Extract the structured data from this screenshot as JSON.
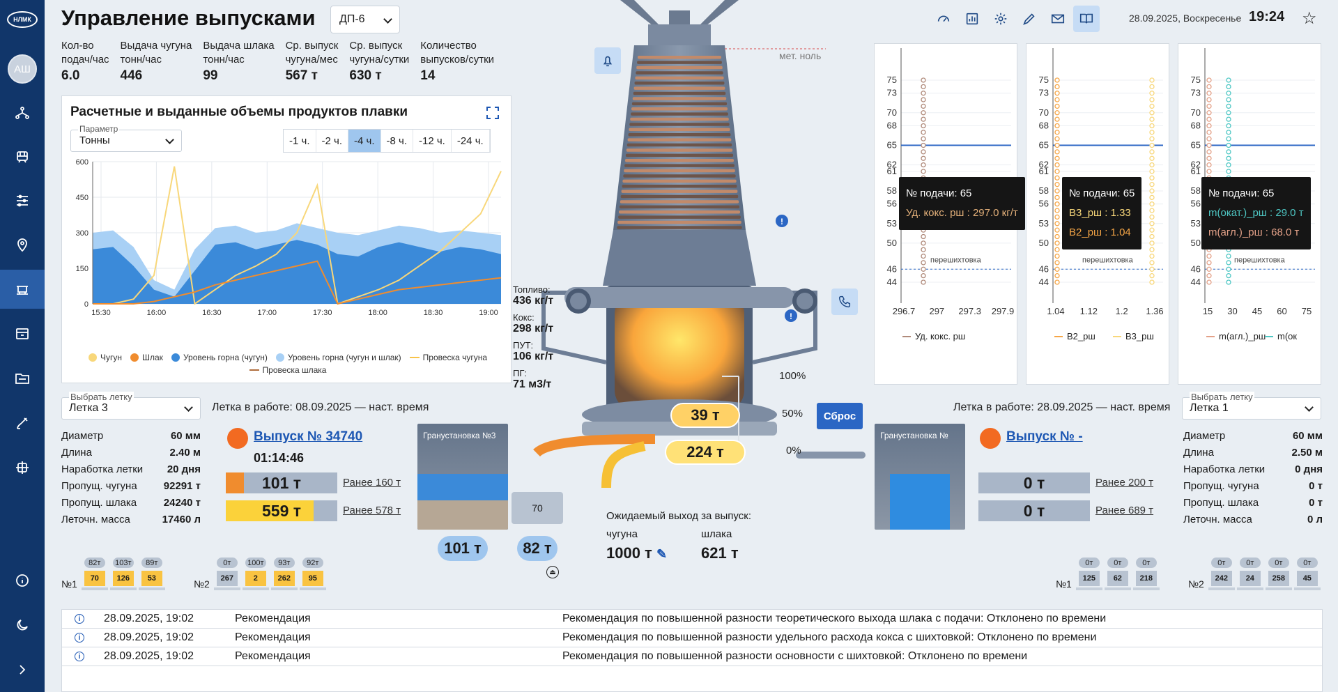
{
  "app": {
    "logo": "НЛМК",
    "user_initials": "АШ"
  },
  "header": {
    "title": "Управление выпусками",
    "furnace": "ДП-6",
    "date": "28.09.2025, Воскресенье",
    "time": "19:24"
  },
  "stats": [
    {
      "label": "Кол-во\nподач/час",
      "value": "6.0"
    },
    {
      "label": "Выдача чугуна\nтонн/час",
      "value": "446"
    },
    {
      "label": "Выдача шлака\nтонн/час",
      "value": "99"
    },
    {
      "label": "Ср. выпуск\nчугуна/мес",
      "value": "567 т"
    },
    {
      "label": "Ср. выпуск\nчугуна/сутки",
      "value": "630 т"
    },
    {
      "label": "Количество\nвыпусков/сутки",
      "value": "14"
    }
  ],
  "chart_panel": {
    "title": "Расчетные и выданные объемы продуктов плавки",
    "param_label": "Параметр",
    "param_value": "Тонны",
    "hour_buttons": [
      "-1 ч.",
      "-2 ч.",
      "-4 ч.",
      "-8 ч.",
      "-12 ч.",
      "-24 ч."
    ],
    "active_hour": "-4 ч.",
    "legend": [
      "Чугун",
      "Шлак",
      "Уровень горна (чугун)",
      "Уровень горна (чугун и шлак)",
      "Провеска чугуна",
      "Провеска шлака"
    ]
  },
  "chart_data": [
    {
      "type": "area",
      "title": "Расчетные и выданные объемы продуктов плавки",
      "x_ticks": [
        "15:30",
        "16:00",
        "16:30",
        "17:00",
        "17:30",
        "18:00",
        "18:30",
        "19:00"
      ],
      "y_ticks": [
        0,
        150,
        300,
        450,
        600
      ],
      "ylim": [
        0,
        600
      ],
      "series": [
        {
          "name": "Уровень горна (чугун и шлак)",
          "color": "#a8d0f5",
          "values": [
            300,
            310,
            240,
            100,
            60,
            230,
            320,
            330,
            300,
            310,
            340,
            320,
            300,
            290,
            310,
            330,
            320,
            300,
            310,
            300,
            290
          ]
        },
        {
          "name": "Уровень горна (чугун)",
          "color": "#3b8ad9",
          "values": [
            230,
            240,
            160,
            60,
            30,
            140,
            250,
            260,
            230,
            250,
            270,
            250,
            210,
            200,
            240,
            260,
            240,
            220,
            240,
            230,
            210
          ]
        },
        {
          "name": "Чугун",
          "color": "#f8d77a",
          "values": [
            0,
            0,
            20,
            120,
            580,
            0,
            60,
            120,
            160,
            210,
            300,
            500,
            0,
            30,
            60,
            100,
            160,
            220,
            300,
            380,
            560
          ]
        },
        {
          "name": "Шлак",
          "color": "#f08c2e",
          "values": [
            0,
            0,
            0,
            10,
            30,
            50,
            80,
            100,
            120,
            140,
            160,
            180,
            0,
            20,
            40,
            60,
            70,
            80,
            90,
            100,
            110
          ]
        }
      ]
    },
    {
      "type": "scatter",
      "title": "",
      "xlabel": "Уд. кокс. рш",
      "x_ticks": [
        "296.7",
        "297",
        "297.3",
        "297.9"
      ],
      "y_ticks": [
        44,
        46,
        50,
        53,
        56,
        58,
        61,
        62,
        65,
        68,
        70,
        73,
        75
      ]
    },
    {
      "type": "scatter",
      "title": "",
      "x_ticks": [
        "1.04",
        "1.12",
        "1.2",
        "1.36"
      ],
      "legend": [
        "B2_рш",
        "B3_рш"
      ],
      "y_ticks": [
        44,
        46,
        50,
        53,
        56,
        58,
        61,
        62,
        65,
        68,
        70,
        73,
        75
      ]
    },
    {
      "type": "scatter",
      "title": "",
      "x_ticks": [
        "15",
        "30",
        "45",
        "60",
        "75"
      ],
      "legend": [
        "m(агл.)_рш",
        "m(ок"
      ],
      "y_ticks": [
        44,
        46,
        50,
        53,
        56,
        58,
        61,
        62,
        65,
        68,
        70,
        73,
        75
      ]
    }
  ],
  "mini_charts": {
    "marker": "перешихтовка",
    "tips": [
      {
        "line1": "№ подачи: 65",
        "line2": "Уд. кокс. рш : 297.0 кг/т",
        "line3": ""
      },
      {
        "line1": "№ подачи: 65",
        "line2": "B3_рш : 1.33",
        "line3": "B2_рш : 1.04"
      },
      {
        "line1": "№ подачи: 65",
        "line2": "m(окат.)_рш : 29.0 т",
        "line3": "m(агл.)_рш : 68.0 т"
      }
    ]
  },
  "furnace": {
    "zero_label": "мет. ноль",
    "fuel": [
      {
        "k": "Топливо:",
        "v": "436 кг/т"
      },
      {
        "k": "Кокс:",
        "v": "298 кг/т"
      },
      {
        "k": "ПУТ:",
        "v": "106 кг/т"
      },
      {
        "k": "ПГ:",
        "v": "71 м3/т"
      }
    ],
    "level_100": "100%",
    "level_50": "50%",
    "level_0": "0%",
    "slag_level": "39 т",
    "iron_level": "224 т",
    "reset": "Сброс",
    "gran_total": "101 т",
    "ladle_total": "82 т",
    "ladle_mark": "70",
    "expected_title": "Ожидаемый выход за выпуск:",
    "expected_iron_label": "чугуна",
    "expected_iron": "1000 т",
    "expected_slag_label": "шлака",
    "expected_slag": "621 т"
  },
  "left_tap": {
    "select_label": "Выбрать летку",
    "select_value": "Летка 3",
    "work": "Летка в работе:  08.09.2025 — наст. время",
    "specs": [
      {
        "k": "Диаметр",
        "v": "60 мм"
      },
      {
        "k": "Длина",
        "v": "2.40 м"
      },
      {
        "k": "Наработка летки",
        "v": "20 дня"
      },
      {
        "k": "Пропущ. чугуна",
        "v": "92291 т"
      },
      {
        "k": "Пропущ. шлака",
        "v": "24240 т"
      },
      {
        "k": "Леточн. масса",
        "v": "17460 л"
      }
    ],
    "release": "Выпуск № 34740",
    "timer": "01:14:46",
    "slag_value": "101 т",
    "iron_value": "559 т",
    "slag_earlier": "Ранее 160 т",
    "iron_earlier": "Ранее 578 т",
    "gran": "Гранустановка №3"
  },
  "right_tap": {
    "select_label": "Выбрать летку",
    "select_value": "Летка 1",
    "work": "Летка в работе:  28.09.2025 — наст. время",
    "specs": [
      {
        "k": "Диаметр",
        "v": "60 мм"
      },
      {
        "k": "Длина",
        "v": "2.50 м"
      },
      {
        "k": "Наработка летки",
        "v": "0 дня"
      },
      {
        "k": "Пропущ. чугуна",
        "v": "0 т"
      },
      {
        "k": "Пропущ. шлака",
        "v": "0 т"
      },
      {
        "k": "Леточн. масса",
        "v": "0 л"
      }
    ],
    "release": "Выпуск № -",
    "slag_value": "0 т",
    "iron_value": "0 т",
    "slag_earlier": "Ранее 200 т",
    "iron_earlier": "Ранее 689 т",
    "gran": "Гранустановка №"
  },
  "ladles": {
    "left1": {
      "label": "№1",
      "items": [
        {
          "top": "82т",
          "body": "70"
        },
        {
          "top": "103т",
          "body": "126"
        },
        {
          "top": "89т",
          "body": "53"
        }
      ]
    },
    "left2": {
      "label": "№2",
      "items": [
        {
          "top": "0т",
          "body": "267"
        },
        {
          "top": "100т",
          "body": "2"
        },
        {
          "top": "93т",
          "body": "262"
        },
        {
          "top": "92т",
          "body": "95"
        }
      ]
    },
    "right1": {
      "label": "№1",
      "items": [
        {
          "top": "0т",
          "body": "125"
        },
        {
          "top": "0т",
          "body": "62"
        },
        {
          "top": "0т",
          "body": "218"
        }
      ]
    },
    "right2": {
      "label": "№2",
      "items": [
        {
          "top": "0т",
          "body": "242"
        },
        {
          "top": "0т",
          "body": "24"
        },
        {
          "top": "0т",
          "body": "258"
        },
        {
          "top": "0т",
          "body": "45"
        }
      ]
    }
  },
  "events": [
    {
      "time": "28.09.2025, 19:02",
      "type": "Рекомендация",
      "text": "Рекомендация по повышенной разности теоретического выхода шлака с подачи: Отклонено по времени"
    },
    {
      "time": "28.09.2025, 19:02",
      "type": "Рекомендация",
      "text": "Рекомендация по повышенной разности удельного расхода кокса с шихтовкой: Отклонено по времени"
    },
    {
      "time": "28.09.2025, 19:02",
      "type": "Рекомендация",
      "text": "Рекомендация по повышенной разности основности с шихтовкой: Отклонено по времени"
    }
  ]
}
